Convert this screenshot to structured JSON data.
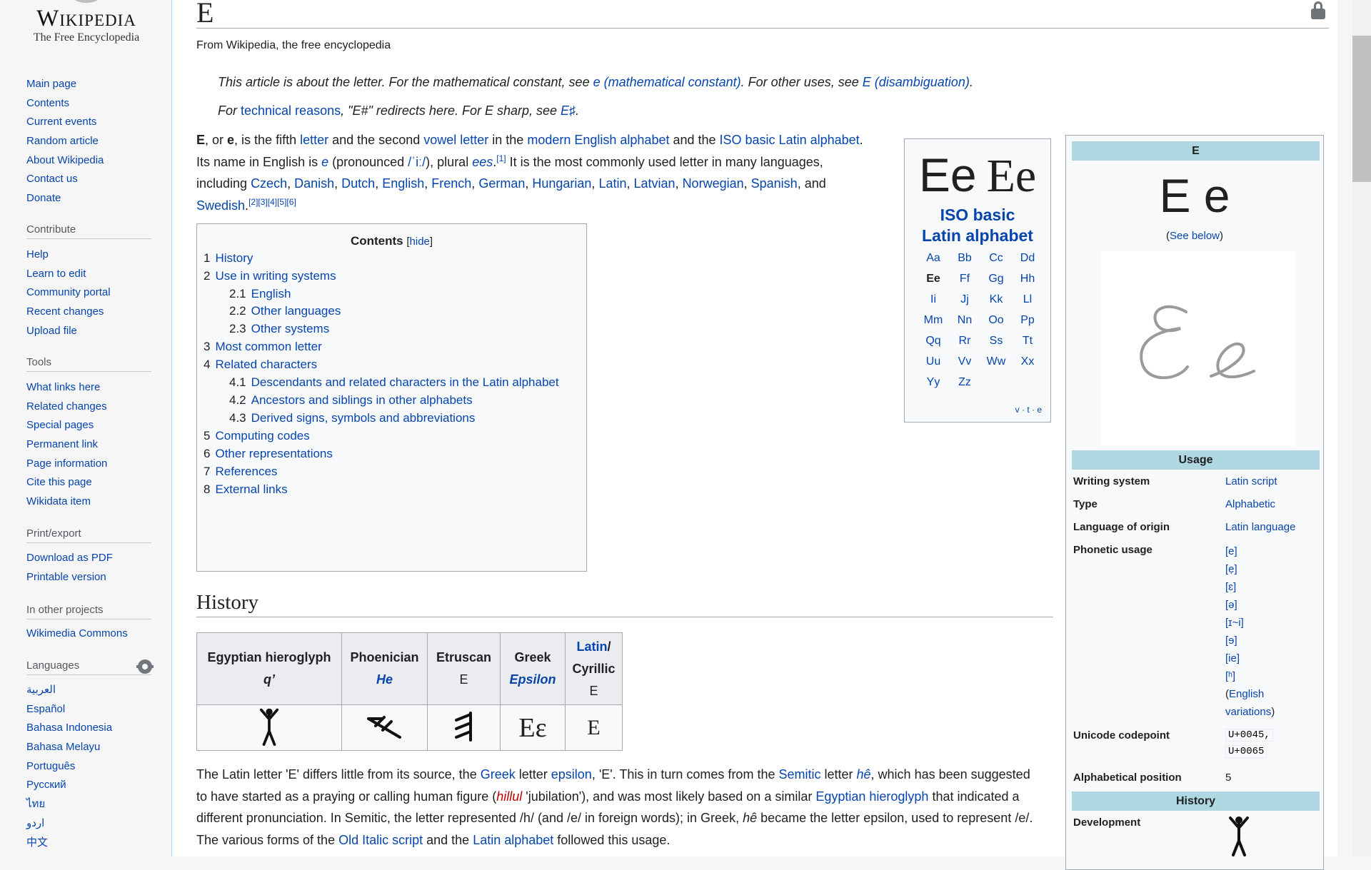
{
  "logo": {
    "wordmark": "Wikipedia",
    "tagline": "The Free Encyclopedia"
  },
  "sidebar": {
    "main_nav": [
      "Main page",
      "Contents",
      "Current events",
      "Random article",
      "About Wikipedia",
      "Contact us",
      "Donate"
    ],
    "contribute": {
      "heading": "Contribute",
      "items": [
        "Help",
        "Learn to edit",
        "Community portal",
        "Recent changes",
        "Upload file"
      ]
    },
    "tools": {
      "heading": "Tools",
      "items": [
        "What links here",
        "Related changes",
        "Special pages",
        "Permanent link",
        "Page information",
        "Cite this page",
        "Wikidata item"
      ]
    },
    "print": {
      "heading": "Print/export",
      "items": [
        "Download as PDF",
        "Printable version"
      ]
    },
    "projects": {
      "heading": "In other projects",
      "items": [
        "Wikimedia Commons"
      ]
    },
    "languages": {
      "heading": "Languages",
      "items": [
        "العربية",
        "Español",
        "Bahasa Indonesia",
        "Bahasa Melayu",
        "Português",
        "Русский",
        "ไทย",
        "اردو",
        "中文"
      ]
    }
  },
  "article": {
    "title": "E",
    "site_sub": "From Wikipedia, the free encyclopedia",
    "hatnote1": {
      "t1": "This article is about the letter. For the mathematical constant, see ",
      "l1": "e (mathematical constant)",
      "t2": ". For other uses, see ",
      "l2": "E (disambiguation)",
      "t3": "."
    },
    "hatnote2": {
      "t1": "For ",
      "l1": "technical reasons",
      "t2": ", \"E#\" redirects here. For E sharp, see ",
      "l2": "E♯",
      "t3": "."
    },
    "lead": {
      "b1": "E",
      "t1": ", or ",
      "b2": "e",
      "t2": ", is the fifth ",
      "l_letter": "letter",
      "t3": " and the second ",
      "l_vowel": "vowel letter",
      "t4": " in the ",
      "l_modern": "modern English alphabet",
      "t5": " and the ",
      "l_iso": "ISO basic Latin alphabet",
      "t6": ". Its name in English is ",
      "l_e": "e",
      "t7": " (pronounced ",
      "l_ipa": "/ˈiː/",
      "t8": "), plural ",
      "l_ees": "ees",
      "t9": ".",
      "ref1": "[1]",
      "t10": " It is the most commonly used letter in many languages, including ",
      "langs": [
        "Czech",
        "Danish",
        "Dutch",
        "English",
        "French",
        "German",
        "Hungarian",
        "Latin",
        "Latvian",
        "Norwegian",
        "Spanish"
      ],
      "t_and": "and",
      "last_lang": "Swedish",
      "refs": "[2][3][4][5][6]"
    },
    "toc": {
      "title": "Contents",
      "hide": "hide",
      "items": [
        {
          "num": "1",
          "label": "History"
        },
        {
          "num": "2",
          "label": "Use in writing systems"
        },
        {
          "num": "2.1",
          "label": "English"
        },
        {
          "num": "2.2",
          "label": "Other languages"
        },
        {
          "num": "2.3",
          "label": "Other systems"
        },
        {
          "num": "3",
          "label": "Most common letter"
        },
        {
          "num": "4",
          "label": "Related characters"
        },
        {
          "num": "4.1",
          "label": "Descendants and related characters in the Latin alphabet"
        },
        {
          "num": "4.2",
          "label": "Ancestors and siblings in other alphabets"
        },
        {
          "num": "4.3",
          "label": "Derived signs, symbols and abbreviations"
        },
        {
          "num": "5",
          "label": "Computing codes"
        },
        {
          "num": "6",
          "label": "Other representations"
        },
        {
          "num": "7",
          "label": "References"
        },
        {
          "num": "8",
          "label": "External links"
        }
      ]
    },
    "letterbox": {
      "sans": "Ee",
      "serif": "Ee",
      "iso1": "ISO basic",
      "iso2": "Latin alphabet",
      "letters": [
        "Aa",
        "Bb",
        "Cc",
        "Dd",
        "Ee",
        "Ff",
        "Gg",
        "Hh",
        "Ii",
        "Jj",
        "Kk",
        "Ll",
        "Mm",
        "Nn",
        "Oo",
        "Pp",
        "Qq",
        "Rr",
        "Ss",
        "Tt",
        "Uu",
        "Vv",
        "Ww",
        "Xx",
        "Yy",
        "Zz"
      ],
      "current": "Ee",
      "vte": "v · t · e"
    },
    "infobox": {
      "title": "E",
      "glyph": "E e",
      "see_below_open": "(",
      "see_below": "See below",
      "see_below_close": ")",
      "usage_header": "Usage",
      "writing_system_label": "Writing system",
      "writing_system": "Latin script",
      "type_label": "Type",
      "type": "Alphabetic",
      "origin_label": "Language of origin",
      "origin": "Latin language",
      "phonetic_label": "Phonetic usage",
      "phonetic": [
        "[e]",
        "[ẹ]",
        "[ɛ]",
        "[ə]",
        "[ɪ~i]",
        "[ɘ]",
        "[ie]",
        "[ʰ]"
      ],
      "phonetic_more_open": "(",
      "phonetic_more1": "English",
      "phonetic_more2": "variations",
      "phonetic_more_close": ")",
      "unicode_label": "Unicode codepoint",
      "unicode1": "U+0045,",
      "unicode2": "U+0065",
      "alpha_label": "Alphabetical position",
      "alpha": "5",
      "history_header": "History",
      "development_label": "Development"
    },
    "history": {
      "heading": "History",
      "table": {
        "headers": [
          {
            "l1": "Egyptian hieroglyph",
            "l2": "q’"
          },
          {
            "l1": "Phoenician",
            "l2": "He"
          },
          {
            "l1": "Etruscan",
            "l2": "E"
          },
          {
            "l1": "Greek",
            "l2": "Epsilon"
          },
          {
            "l1": "Latin",
            "l1b": "/",
            "l2": "Cyrillic",
            "l3": "E"
          }
        ],
        "glyphs": [
          "𓀠",
          "",
          "",
          "Εε",
          "E"
        ]
      },
      "para": {
        "t1": "The Latin letter 'E' differs little from its source, the ",
        "l1": "Greek",
        "t2": " letter ",
        "l2": "epsilon",
        "t3": ", 'E'. This in turn comes from the ",
        "l3": "Semitic",
        "t4": " letter ",
        "l4": "hê",
        "t5": ", which has been suggested to have started as a praying or calling human figure (",
        "red": "hillul",
        "t6": " 'jubilation'), and was most likely based on a similar ",
        "l5": "Egyptian hieroglyph",
        "t7": " that indicated a different pronunciation. In Semitic, the letter represented /h/ (and /e/ in foreign words); in Greek, ",
        "i1": "hê",
        "t8": " became the letter epsilon, used to represent /e/. The various forms of the ",
        "l6": "Old Italic script",
        "t9": " and the ",
        "l7": "Latin alphabet",
        "t10": " followed this usage."
      }
    }
  }
}
